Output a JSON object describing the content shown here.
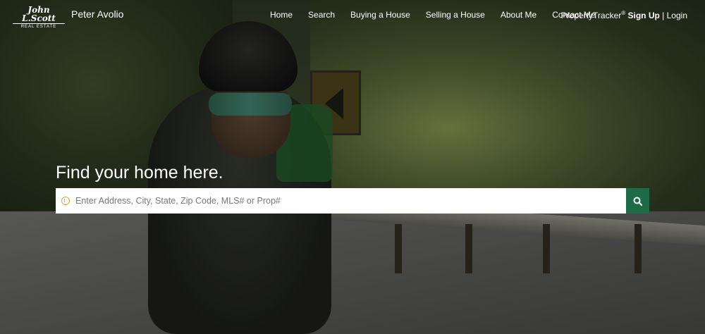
{
  "brand": {
    "logo_main": "John L.Scott",
    "logo_sub": "REAL ESTATE",
    "agent_name": "Peter Avolio"
  },
  "nav": {
    "items": [
      {
        "label": "Home"
      },
      {
        "label": "Search"
      },
      {
        "label": "Buying a House"
      },
      {
        "label": "Selling a House"
      },
      {
        "label": "About Me"
      },
      {
        "label": "Contact Me"
      }
    ],
    "property_tracker": "PropertyTracker",
    "registered_mark": "®",
    "sign_up": "Sign Up",
    "separator": "|",
    "login": "Login"
  },
  "hero": {
    "headline": "Find your home here.",
    "search_placeholder": "Enter Address, City, State, Zip Code, MLS# or Prop#"
  },
  "icons": {
    "location": "location-pin-icon",
    "search": "search-icon"
  },
  "colors": {
    "search_button": "#1e6b47",
    "pin_accent": "#e0a437"
  }
}
